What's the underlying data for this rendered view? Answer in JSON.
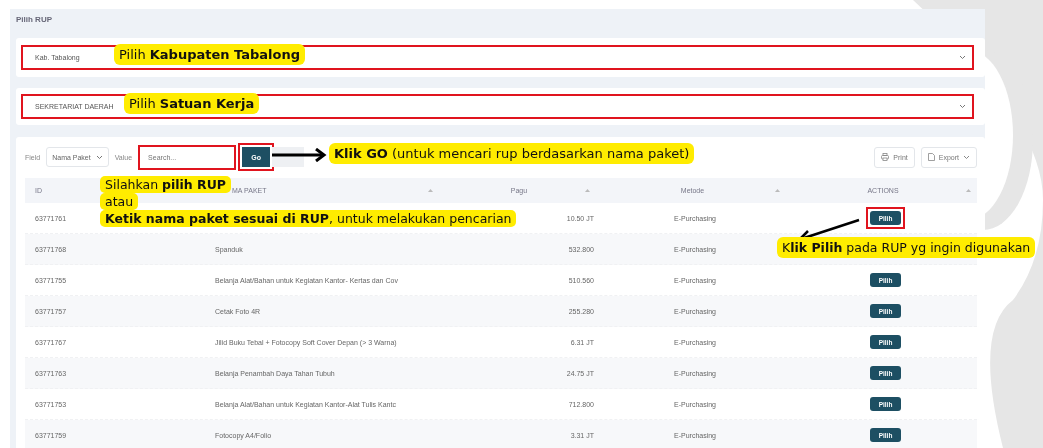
{
  "page_title": "Pilih RUP",
  "kabupaten_select": {
    "value": "Kab. Tabalong",
    "highlighted": true
  },
  "satker_select": {
    "value": "SEKRETARIAT DAERAH",
    "highlighted": true
  },
  "filter": {
    "field_label": "Field",
    "field_value": "Nama Paket",
    "value_label": "Value",
    "search": {
      "placeholder": "Search...",
      "highlighted": true
    },
    "go_button": {
      "label": "Go",
      "highlighted": true
    }
  },
  "toolbar_buttons": [
    {
      "label": "Print",
      "kind": "print"
    },
    {
      "label": "Export",
      "kind": "export"
    }
  ],
  "table": {
    "columns": [
      {
        "label": "ID",
        "sortable": false
      },
      {
        "label": "MA PAKET",
        "sortable": true
      },
      {
        "label": "Pagu",
        "sortable": true
      },
      {
        "label": "Metode",
        "sortable": true
      },
      {
        "label": "ACTIONS",
        "sortable": true
      }
    ],
    "rows": [
      {
        "id": "63771761",
        "pagu": "10.50 JT",
        "metode": "E-Purchasing",
        "action": {
          "label": "Pilih",
          "highlighted": true
        }
      },
      {
        "id": "63771768",
        "nama_paket": "Spanduk",
        "pagu": "532.800",
        "metode": "E-Purchasing"
      },
      {
        "id": "63771755",
        "nama_paket": "Belanja Alat/Bahan untuk Kegiatan Kantor- Kertas dan Cov",
        "pagu": "510.560",
        "metode": "E-Purchasing",
        "action": {
          "label": "Pilih",
          "highlighted": false
        }
      },
      {
        "id": "63771757",
        "nama_paket": "Cetak Foto 4R",
        "pagu": "255.280",
        "metode": "E-Purchasing",
        "action": {
          "label": "Pilih",
          "highlighted": false
        }
      },
      {
        "id": "63771767",
        "nama_paket": "Jilid Buku Tebal + Fotocopy Soft Cover Depan (> 3 Warna)",
        "pagu": "6.31 JT",
        "metode": "E-Purchasing",
        "action": {
          "label": "Pilih",
          "highlighted": false
        }
      },
      {
        "id": "63771763",
        "nama_paket": "Belanja Penambah Daya Tahan Tubuh",
        "pagu": "24.75 JT",
        "metode": "E-Purchasing",
        "action": {
          "label": "Pilih",
          "highlighted": false
        }
      },
      {
        "id": "63771753",
        "nama_paket": "Belanja Alat/Bahan untuk Kegiatan Kantor-Alat Tulis Kantc",
        "pagu": "712.800",
        "metode": "E-Purchasing",
        "action": {
          "label": "Pilih",
          "highlighted": false
        }
      },
      {
        "id": "63771759",
        "nama_paket": "Fotocopy A4/Folio",
        "pagu": "3.31 JT",
        "metode": "E-Purchasing",
        "action": {
          "label": "Pilih",
          "highlighted": false
        }
      }
    ]
  },
  "annotations": {
    "kabupaten": "Pilih **Kabupaten Tabalong**",
    "satker": "Pilih **Satuan Kerja**",
    "go": "**Klik GO** (untuk mencari rup berdasarkan nama paket)",
    "search_lines": [
      "Silahkan **pilih RUP**",
      "atau",
      "**Ketik nama paket sesuai di RUP**, untuk melakukan pencarian"
    ],
    "pilih": "K**lik Pilih** pada RUP yg ingin digunakan"
  }
}
